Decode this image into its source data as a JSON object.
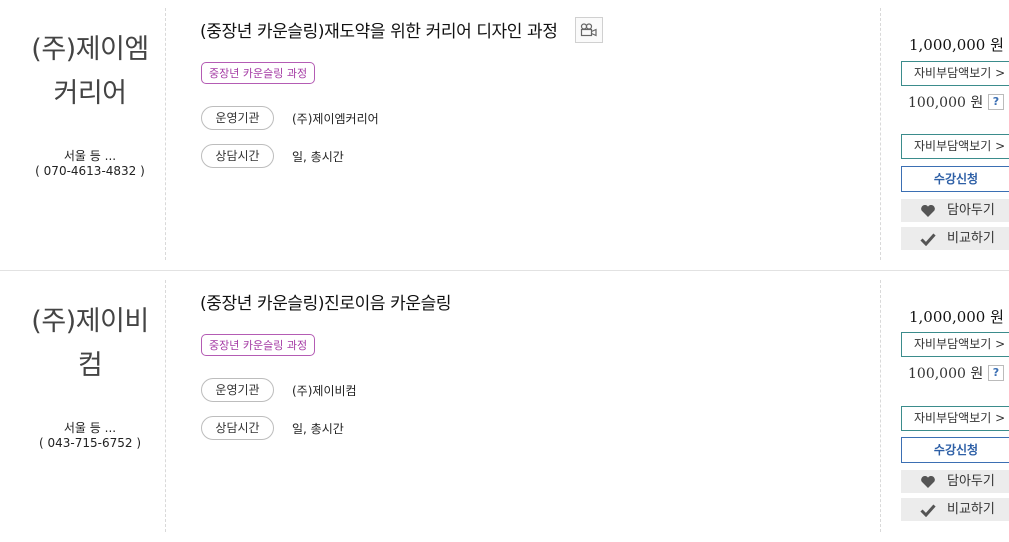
{
  "listings": [
    {
      "org_name_line1": "(주)제이엠",
      "org_name_line2": "커리어",
      "location": "서울 등 ...",
      "phone": "( 070-4613-4832 )",
      "title": "(중장년 카운슬링)재도약을 위한 커리어 디자인 과정",
      "has_video": true,
      "tag": "중장년 카운슬링 과정",
      "info": [
        {
          "label": "운영기관",
          "value": "(주)제이엠커리어"
        },
        {
          "label": "상담시간",
          "value": "일, 총시간"
        }
      ],
      "price": "1,000,000 원",
      "self_pay_btn": "자비부담액보기 >",
      "sub_price": "100,000 원",
      "help": "?",
      "self_pay_btn2": "자비부담액보기 >",
      "apply_btn": "수강신청",
      "wishlist_btn": "담아두기",
      "compare_btn": "비교하기"
    },
    {
      "org_name_line1": "(주)제이비",
      "org_name_line2": "컴",
      "location": "서울 등 ...",
      "phone": "( 043-715-6752 )",
      "title": "(중장년 카운슬링)진로이음 카운슬링",
      "has_video": false,
      "tag": "중장년 카운슬링 과정",
      "info": [
        {
          "label": "운영기관",
          "value": "(주)제이비컴"
        },
        {
          "label": "상담시간",
          "value": "일, 총시간"
        }
      ],
      "price": "1,000,000 원",
      "self_pay_btn": "자비부담액보기 >",
      "sub_price": "100,000 원",
      "help": "?",
      "self_pay_btn2": "자비부담액보기 >",
      "apply_btn": "수강신청",
      "wishlist_btn": "담아두기",
      "compare_btn": "비교하기"
    }
  ],
  "colors": {
    "tag_border": "#b45cb4",
    "tag_text": "#a43aa4",
    "teal_border": "#3b8c8c",
    "apply_blue": "#2d5fa6",
    "gray_btn_bg": "#ececec"
  }
}
